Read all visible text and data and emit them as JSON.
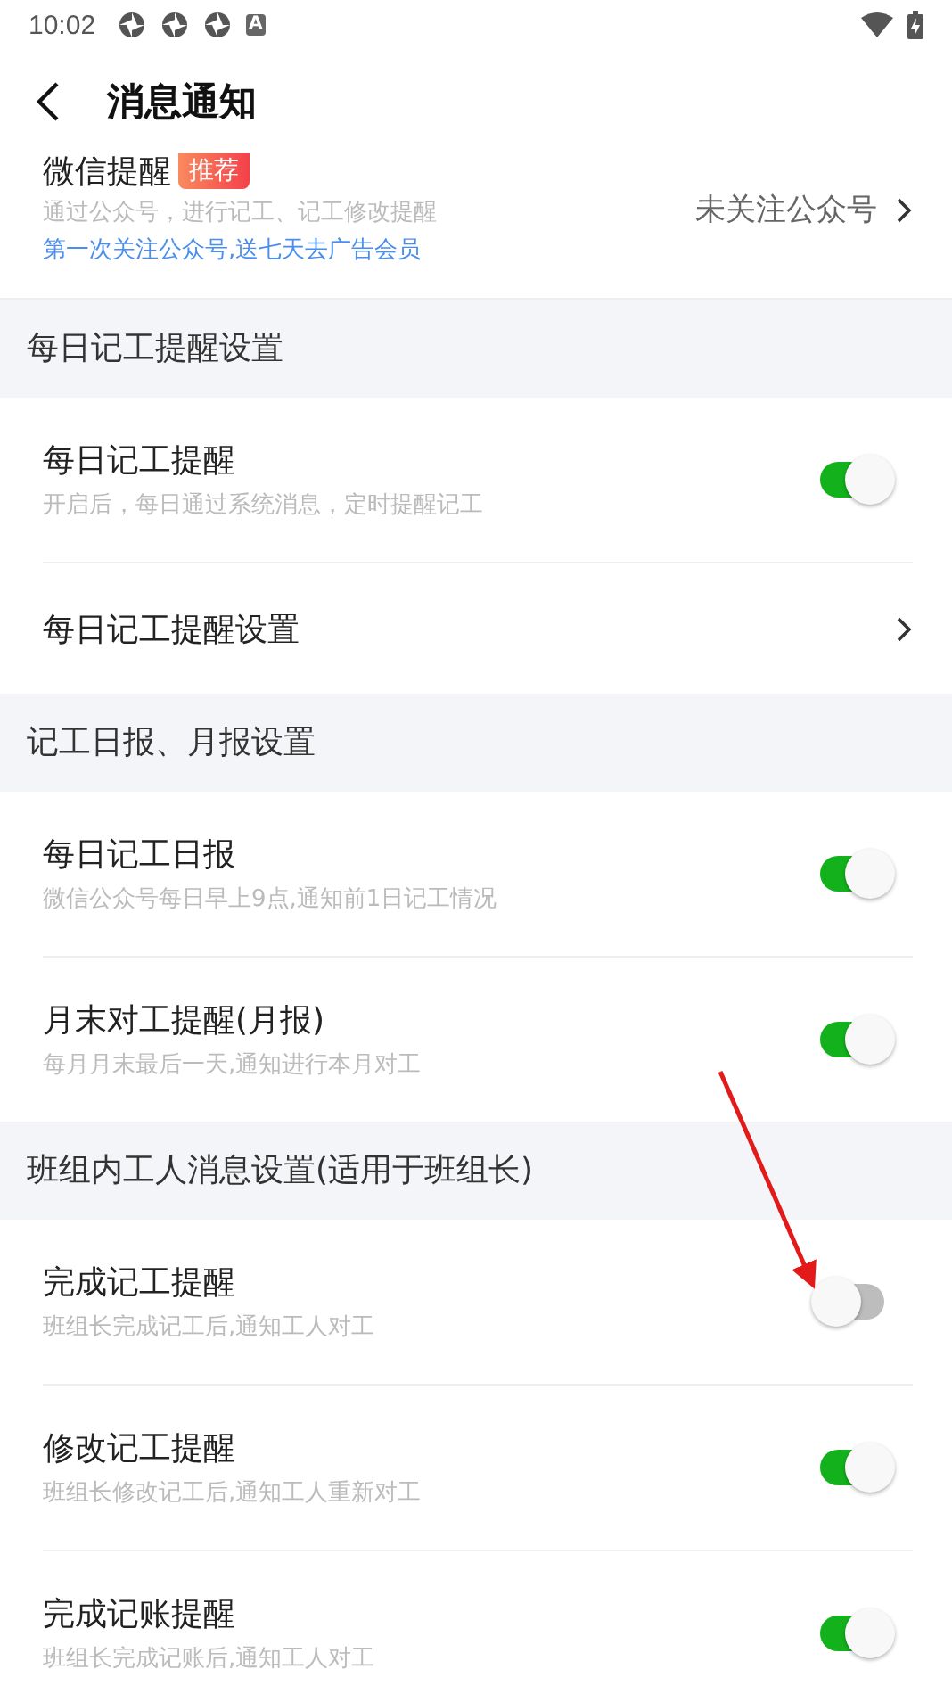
{
  "status_bar": {
    "time": "10:02",
    "badge": "A"
  },
  "header": {
    "title": "消息通知"
  },
  "wechat": {
    "title": "微信提醒",
    "tag": "推荐",
    "description": "通过公众号，进行记工、记工修改提醒",
    "promo": "第一次关注公众号,送七天去广告会员",
    "value": "未关注公众号"
  },
  "sections": [
    {
      "title": "每日记工提醒设置",
      "items": [
        {
          "kind": "toggle",
          "title": "每日记工提醒",
          "description": "开启后，每日通过系统消息，定时提醒记工",
          "on": true
        },
        {
          "kind": "link",
          "title": "每日记工提醒设置"
        }
      ]
    },
    {
      "title": "记工日报、月报设置",
      "items": [
        {
          "kind": "toggle",
          "title": "每日记工日报",
          "description": "微信公众号每日早上9点,通知前1日记工情况",
          "on": true
        },
        {
          "kind": "toggle",
          "title": "月末对工提醒(月报)",
          "description": "每月月末最后一天,通知进行本月对工",
          "on": true
        }
      ]
    },
    {
      "title": "班组内工人消息设置(适用于班组长)",
      "items": [
        {
          "kind": "toggle",
          "title": "完成记工提醒",
          "description": "班组长完成记工后,通知工人对工",
          "on": false
        },
        {
          "kind": "toggle",
          "title": "修改记工提醒",
          "description": "班组长修改记工后,通知工人重新对工",
          "on": true
        },
        {
          "kind": "toggle",
          "title": "完成记账提醒",
          "description": "班组长完成记账后,通知工人对工",
          "on": true
        }
      ]
    }
  ]
}
